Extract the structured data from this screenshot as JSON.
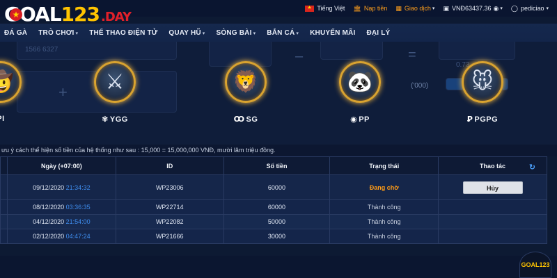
{
  "brand": {
    "name_part1": "GOAL",
    "name_part2": "123",
    "name_part3": ".DAY"
  },
  "topbar": {
    "language": "Tiếng Việt",
    "deposit": "Nạp tiền",
    "transactions": "Giao dịch",
    "balance": "VNĐ63437.36",
    "username": "pediciao"
  },
  "nav": {
    "items": [
      {
        "label": "ĐÁ GÀ",
        "dropdown": false
      },
      {
        "label": "TRÒ CHƠI",
        "dropdown": true
      },
      {
        "label": "THỂ THAO ĐIỆN TỬ",
        "dropdown": false
      },
      {
        "label": "QUAY HŨ",
        "dropdown": true
      },
      {
        "label": "SÒNG BÀI",
        "dropdown": true
      },
      {
        "label": "BẮN CÁ",
        "dropdown": true
      },
      {
        "label": "KHUYẾN MÃI",
        "dropdown": false
      },
      {
        "label": "ĐẠI LÝ",
        "dropdown": false
      }
    ]
  },
  "background_form": {
    "account_text": "1566 6327",
    "rate_text": "0.73",
    "unit_text": "('000)"
  },
  "games": [
    {
      "label": "PI",
      "icon": "cowboy-figure"
    },
    {
      "label": "YGG",
      "icon": "warrior-woman"
    },
    {
      "label": "SG",
      "icon": "lion-warrior"
    },
    {
      "label": "PP",
      "icon": "panda"
    },
    {
      "label": "PGPG",
      "icon": "lucky-mouse"
    }
  ],
  "notice": "ưu ý cách thể hiện số tiền của hệ thống như sau : 15,000 = 15,000,000 VNĐ, mười lăm triệu đồng.",
  "table": {
    "headers": [
      "Ngày (+07:00)",
      "ID",
      "Số tiền",
      "Trạng thái",
      "Thao tác"
    ],
    "rows": [
      {
        "date": "09/12/2020",
        "time": "21:34:32",
        "id": "WP23006",
        "amount": "60000",
        "status": "Đang chờ",
        "action": "Hủy"
      },
      {
        "date": "08/12/2020",
        "time": "03:36:35",
        "id": "WP22714",
        "amount": "60000",
        "status": "Thành công",
        "action": ""
      },
      {
        "date": "04/12/2020",
        "time": "21:54:00",
        "id": "WP22082",
        "amount": "50000",
        "status": "Thành công",
        "action": ""
      },
      {
        "date": "02/12/2020",
        "time": "04:47:24",
        "id": "WP21666",
        "amount": "30000",
        "status": "Thành công",
        "action": ""
      }
    ]
  },
  "fab_label": "GOAL123",
  "colors": {
    "accent": "#ff9b16",
    "link": "#3f8ef0",
    "brand_yellow": "#ffc400",
    "brand_red": "#e0202a"
  }
}
